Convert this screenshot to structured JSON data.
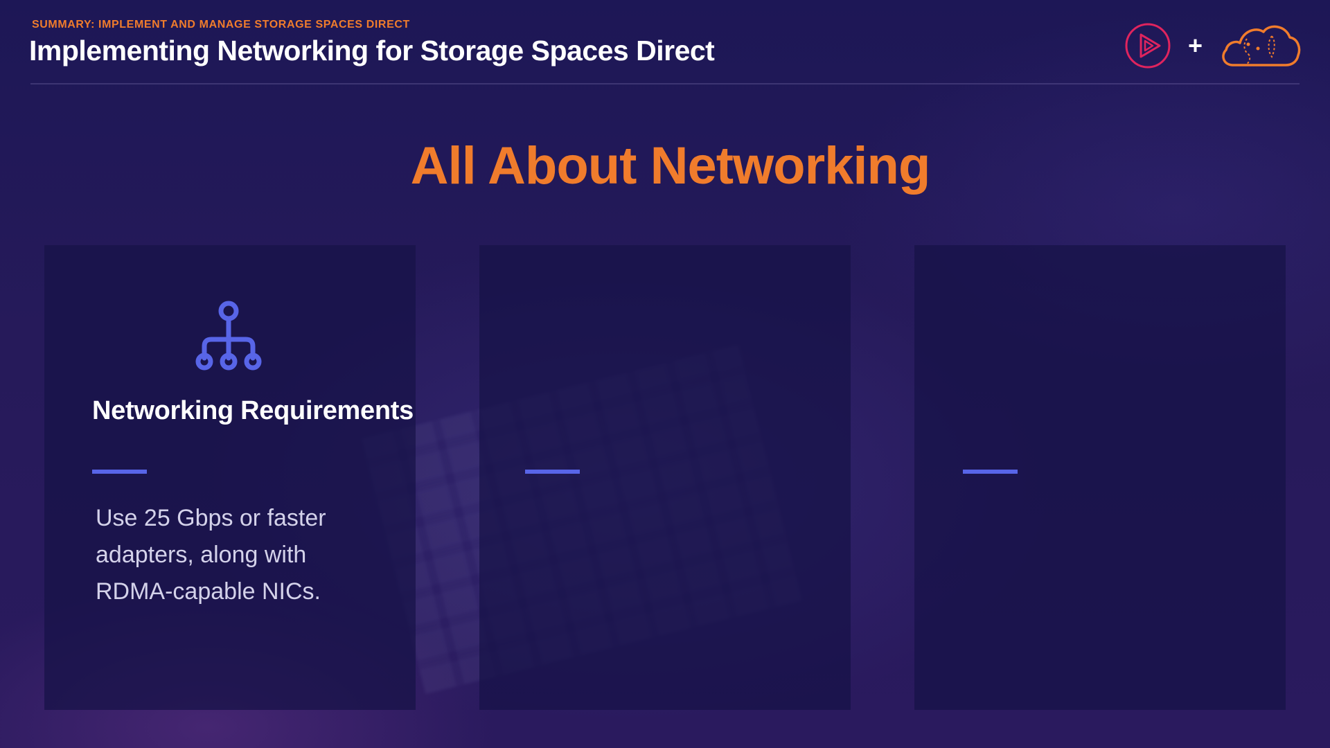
{
  "header": {
    "eyebrow": "SUMMARY: IMPLEMENT AND MANAGE STORAGE SPACES DIRECT",
    "title": "Implementing Networking for Storage Spaces Direct",
    "plus": "+"
  },
  "logos": {
    "play_icon": "play-logo-icon",
    "cloud_icon": "cloud-logo-icon"
  },
  "section": {
    "title": "All About Networking"
  },
  "cards": [
    {
      "icon": "network-hierarchy-icon",
      "heading": "Networking Requirements",
      "body": "Use 25 Gbps or faster adapters, along with RDMA-capable NICs."
    },
    {
      "icon": "",
      "heading": "",
      "body": ""
    },
    {
      "icon": "",
      "heading": "",
      "body": ""
    }
  ],
  "colors": {
    "accent_orange": "#f07c2c",
    "accent_blue": "#5865e8",
    "background": "#1d1756",
    "card_background": "#16124a",
    "play_logo": "#e0245e"
  }
}
